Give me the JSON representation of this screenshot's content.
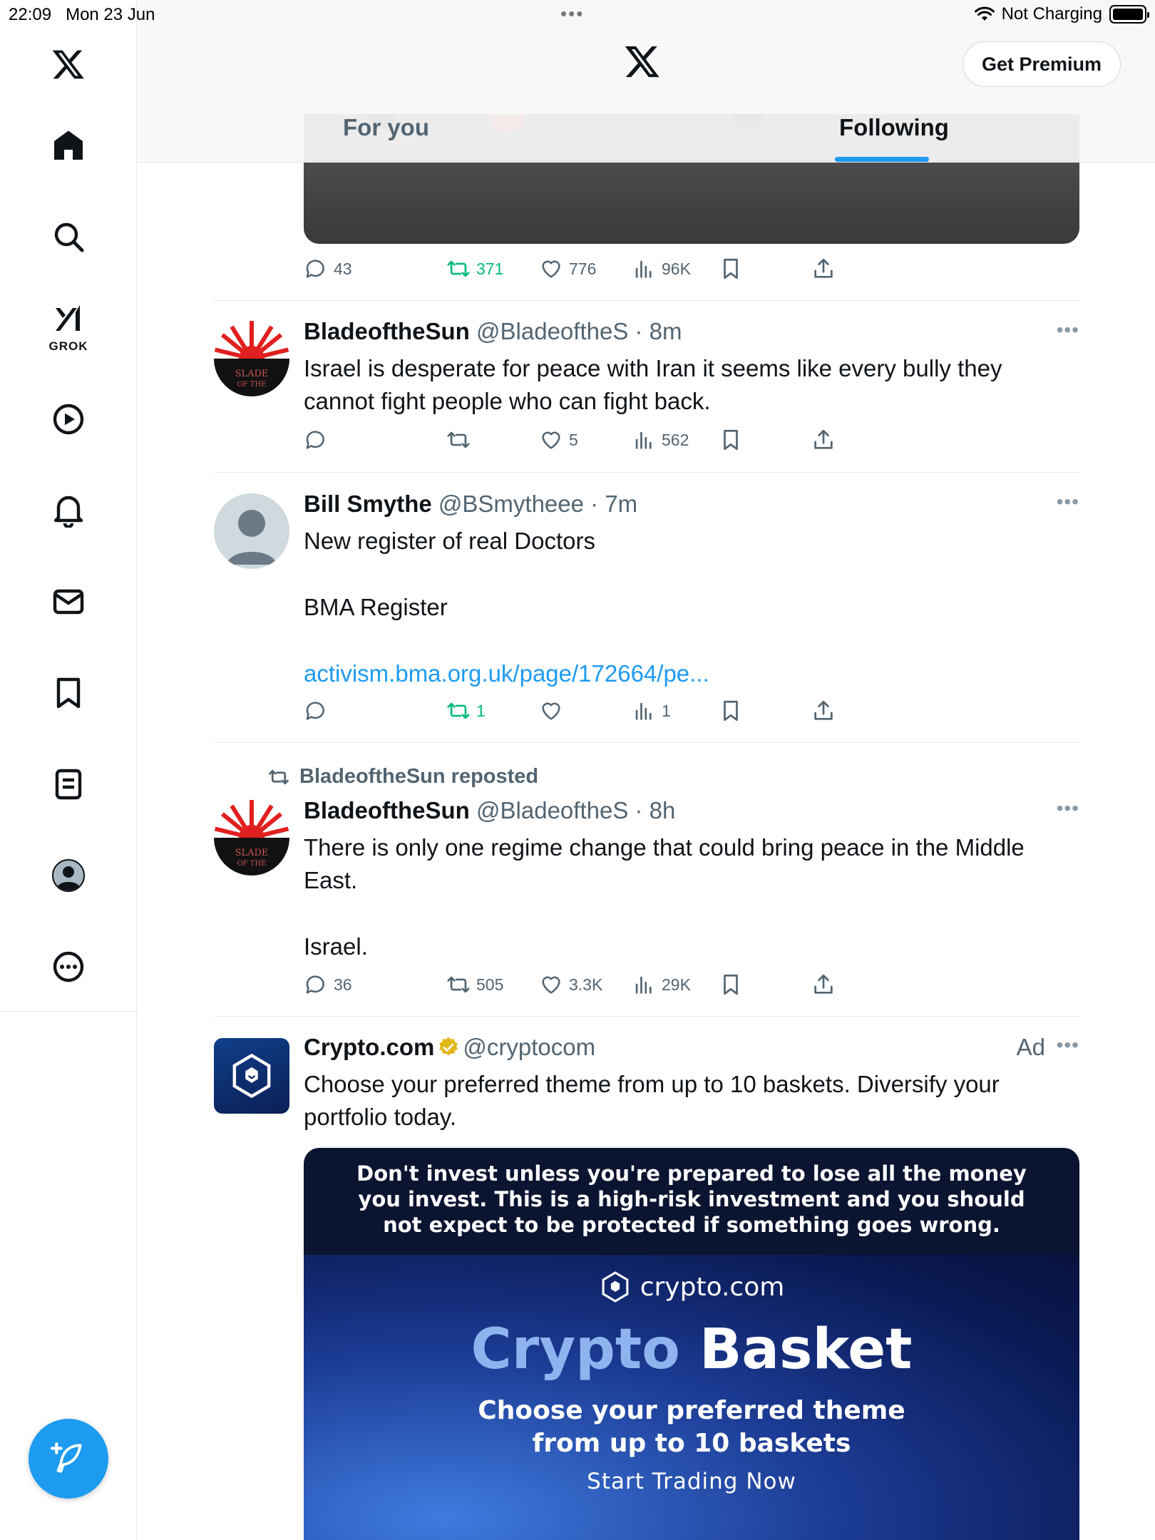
{
  "status_bar": {
    "time": "22:09",
    "date": "Mon 23 Jun",
    "charging": "Not Charging"
  },
  "sidebar": {
    "items": [
      {
        "icon": "x-logo-icon"
      },
      {
        "icon": "home-icon"
      },
      {
        "icon": "search-icon"
      },
      {
        "icon": "grok-icon",
        "label": "GROK"
      },
      {
        "icon": "video-icon"
      },
      {
        "icon": "notifications-icon"
      },
      {
        "icon": "messages-icon"
      },
      {
        "icon": "bookmarks-icon"
      },
      {
        "icon": "lists-icon"
      },
      {
        "icon": "profile-icon"
      },
      {
        "icon": "more-icon"
      }
    ],
    "compose_icon": "compose-icon"
  },
  "header": {
    "premium_label": "Get Premium",
    "tabs": [
      {
        "label": "For you"
      },
      {
        "label": "Following"
      }
    ],
    "active_tab": "Following"
  },
  "feed": {
    "first_actions": {
      "replies": "43",
      "reposts": "371",
      "likes": "776",
      "views": "96K"
    },
    "tweets": [
      {
        "name": "BladeoftheSun",
        "handle": "@BladeoftheS",
        "time": "8m",
        "text": "Israel is desperate for peace with Iran it seems like every bully they cannot fight people who can fight back.",
        "replies": "",
        "reposts": "",
        "likes": "5",
        "views": "562"
      },
      {
        "name": "Bill Smythe",
        "handle": "@BSmytheee",
        "time": "7m",
        "text_lines": [
          "New register of real Doctors",
          "BMA Register"
        ],
        "link": "activism.bma.org.uk/page/172664/pe...",
        "replies": "",
        "reposts": "1",
        "likes": "",
        "views": "1"
      },
      {
        "repost_by": "BladeoftheSun reposted",
        "name": "BladeoftheSun",
        "handle": "@BladeoftheS",
        "time": "8h",
        "text_lines": [
          "There is only one regime change that could bring peace in the Middle East.",
          "Israel."
        ],
        "replies": "36",
        "reposts": "505",
        "likes": "3.3K",
        "views": "29K"
      },
      {
        "name": "Crypto.com",
        "handle": "@cryptocom",
        "ad_label": "Ad",
        "text": "Choose your preferred theme from up to 10 baskets. Diversify your portfolio today.",
        "ad_card": {
          "warning_lines": [
            "Don't invest unless you're prepared to lose all the money",
            "you invest. This is a high-risk investment and you should",
            "not expect to be protected if something goes wrong."
          ],
          "brand": "crypto.com",
          "headline_part1": "Crypto",
          "headline_part2": "Basket",
          "sub_lines": [
            "Choose your preferred theme",
            "from up to 10 baskets"
          ],
          "cta": "Start Trading Now"
        }
      }
    ]
  },
  "colors": {
    "accent": "#1d9bf0",
    "repost_green": "#00ba7c",
    "text": "#0f1419",
    "muted": "#536471"
  }
}
